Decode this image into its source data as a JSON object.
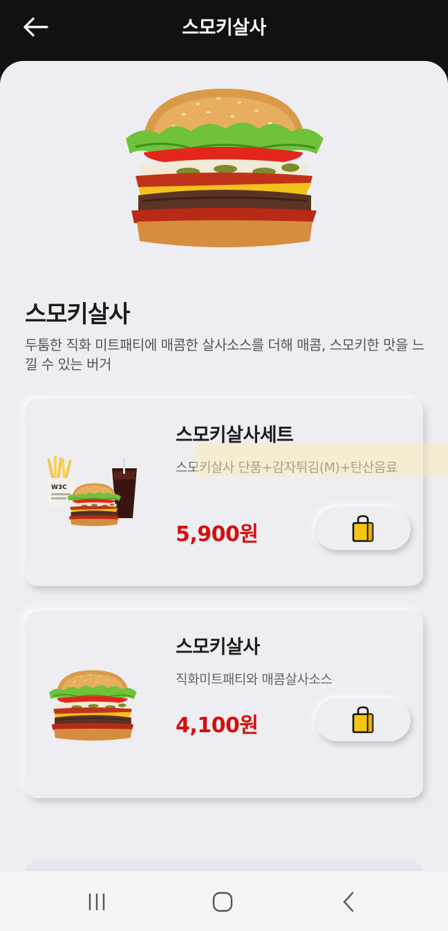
{
  "header": {
    "title": "스모키살사",
    "back_icon": "arrow-left-icon"
  },
  "product": {
    "name": "스모키살사",
    "description": "두툼한 직화 미트패티에 매콤한 살사소스를 더해 매콤, 스모키한 맛을 느낄 수 있는 버거",
    "image_icon": "burger-image"
  },
  "options": [
    {
      "name": "스모키살사세트",
      "detail": "스모키살사 단품+감자튀김(M)+탄산음료",
      "price": "5,900원",
      "cart_icon": "shopping-bag-icon",
      "image_icon": "set-meal-image"
    },
    {
      "name": "스모키살사",
      "detail": "직화미트패티와 매콤살사소스",
      "price": "4,100원",
      "cart_icon": "shopping-bag-icon",
      "image_icon": "burger-image"
    }
  ],
  "nav": {
    "recent_icon": "recent-apps-icon",
    "home_icon": "home-icon",
    "back_icon": "chevron-left-icon"
  },
  "colors": {
    "price": "#d50e0e",
    "bag_fill": "#f5c518",
    "header_bg": "#111111",
    "sheet_bg": "#eeeef2"
  }
}
